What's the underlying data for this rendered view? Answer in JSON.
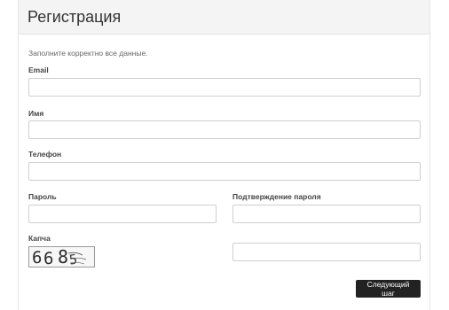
{
  "header": {
    "title": "Регистрация"
  },
  "form": {
    "intro": "Заполните корректно все данные.",
    "email": {
      "label": "Email",
      "value": ""
    },
    "name": {
      "label": "Имя",
      "value": ""
    },
    "phone": {
      "label": "Телефон",
      "value": ""
    },
    "password": {
      "label": "Пароль",
      "value": ""
    },
    "password_confirm": {
      "label": "Подтверждение пароля",
      "value": ""
    },
    "captcha": {
      "label": "Капча",
      "image_text": "6685",
      "value": ""
    },
    "next_label": "Следующий шаг"
  }
}
